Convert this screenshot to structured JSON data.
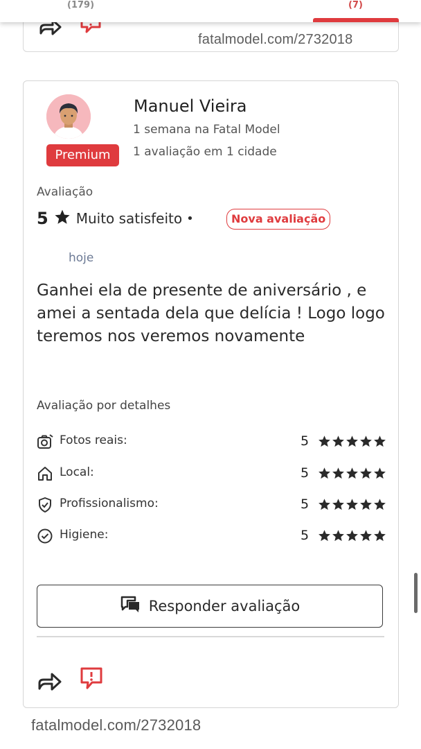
{
  "previous_card": {
    "left_count": "(179)",
    "right_count": "(7)"
  },
  "watermark": {
    "top_text": "fatalmodel.com/2732018",
    "bottom_text": "fatalmodel.com/2732018"
  },
  "reviewer": {
    "name": "Manuel Vieira",
    "badge": "Premium",
    "tenure": "1 semana na Fatal Model",
    "reviews_count": "1 avaliação em 1 cidade"
  },
  "rating": {
    "label": "Avaliação",
    "score": "5",
    "satisfaction": "Muito satisfeito",
    "separator": "•",
    "new_badge": "Nova avaliação",
    "date": "hoje"
  },
  "review": {
    "text": "Ganhei ela de presente de aniversário , e amei a sentada dela que delícia ! Logo logo teremos nos veremos novamente"
  },
  "details": {
    "title": "Avaliação por detalhes",
    "items": [
      {
        "label": "Fotos reais:",
        "score": "5",
        "stars": 5,
        "icon": "camera-icon"
      },
      {
        "label": "Local:",
        "score": "5",
        "stars": 5,
        "icon": "home-icon"
      },
      {
        "label": "Profissionalismo:",
        "score": "5",
        "stars": 5,
        "icon": "shield-check-icon"
      },
      {
        "label": "Higiene:",
        "score": "5",
        "stars": 5,
        "icon": "check-circle-icon"
      }
    ]
  },
  "actions": {
    "reply_label": "Responder avaliação"
  },
  "colors": {
    "accent": "#df3b3e",
    "date_text": "#6c7a95",
    "star": "#2a2a2a"
  }
}
